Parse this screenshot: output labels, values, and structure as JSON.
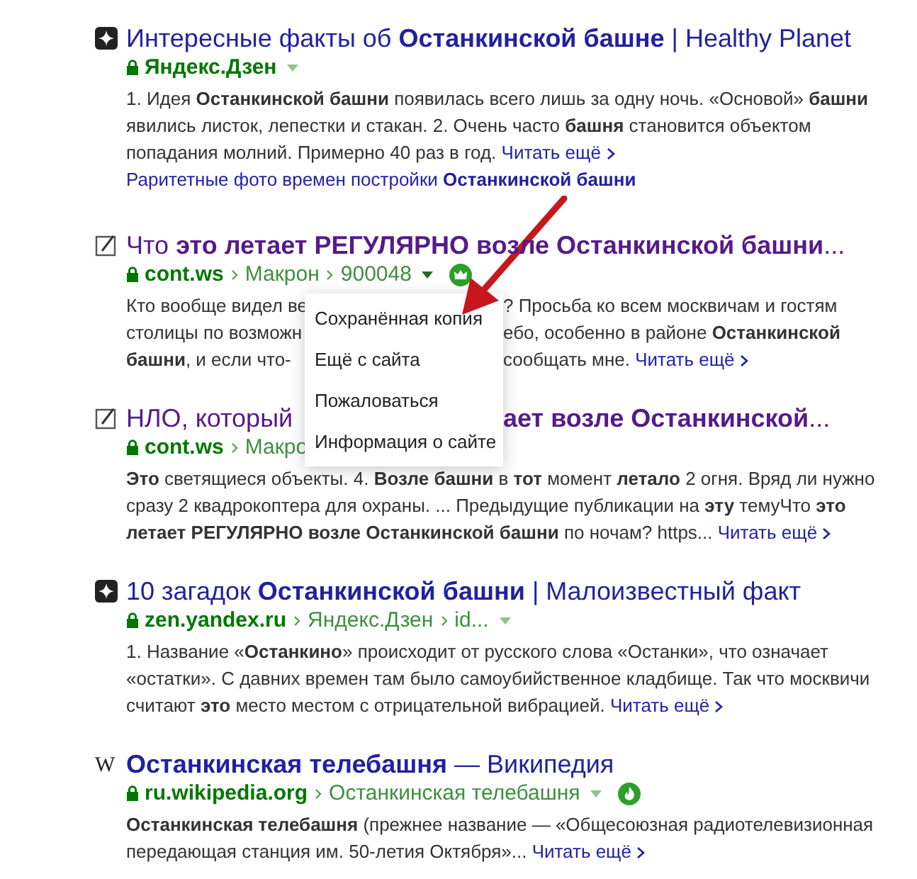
{
  "results": [
    {
      "favicon": {
        "kind": "dzen"
      },
      "visited": false,
      "title_parts": [
        "Интересные факты об **Останкинской башне** | Healthy Planet"
      ],
      "domain": "Яндекс.Дзен",
      "caret": true,
      "snippet": "1. Идея **Останкинской башни** появилась всего лишь за одну ночь. «Основой» **башни** явились листок, лепестки и стакан. 2. Очень часто **башня** становится объектом попадания молний. Примерно 40 раз в год.",
      "read_more": "Читать ещё",
      "sitelink": "Раритетные фото времен постройки **Останкинской башни**"
    },
    {
      "favicon": {
        "kind": "pencil"
      },
      "visited": true,
      "title_parts": [
        "Что **это летает РЕГУЛЯРНО возле Останкинской башни**..."
      ],
      "domain": "cont.ws",
      "breadcrumbs": [
        "Макрон",
        "900048"
      ],
      "caret": true,
      "menu_open": true,
      "badge": {
        "kind": "crown"
      },
      "snippet_lines": [
        {
          "left": "Кто вообще видел ве",
          "right": "? Просьба ко всем москвичам и гостям"
        },
        {
          "left": "столицы по возможн",
          "right": "ебо, особенно в районе **Останкинской**"
        },
        {
          "left": "**башни**, и если что-",
          "right": "сообщать мне."
        }
      ],
      "read_more": "Читать ещё"
    },
    {
      "favicon": {
        "kind": "pencil"
      },
      "visited": true,
      "title_parts": [
        "НЛО, который",
        "**ает возле Останкинской**..."
      ],
      "domain": "cont.ws",
      "breadcrumbs": [
        "Макро"
      ],
      "snippet": "**Это** светящиеся объекты. 4. **Возле башни** в **тот** момент **летало** 2 огня. Вряд ли нужно сразу 2 квадрокоптера для охраны. ... Предыдущие публикации на **эту** темуЧто **это летает РЕГУЛЯРНО возле Останкинской башни** по ночам? https...",
      "read_more": "Читать ещё"
    },
    {
      "favicon": {
        "kind": "dzen"
      },
      "visited": false,
      "title_parts": [
        "10 загадок **Останкинской башни** | Малоизвестный факт"
      ],
      "domain": "zen.yandex.ru",
      "breadcrumbs": [
        "Яндекс.Дзен",
        "id..."
      ],
      "caret": true,
      "snippet": "1. Название «**Останкино**» происходит от русского слова «Останки», что означает «остатки». С давних времен там было самоубийственное кладбище. Так что москвичи считают **это** место местом с отрицательной вибрацией.",
      "read_more": "Читать ещё"
    },
    {
      "favicon": {
        "kind": "letter",
        "letter": "W"
      },
      "visited": false,
      "title_parts": [
        "**Останкинская телебашня** — Википедия"
      ],
      "domain": "ru.wikipedia.org",
      "breadcrumbs": [
        "Останкинская телебашня"
      ],
      "caret": true,
      "badge": {
        "kind": "flame"
      },
      "snippet": "**Останкинская телебашня** (прежнее название — «Общесоюзная радиотелевизионная передающая станция им. 50-летия Октября»...",
      "read_more": "Читать ещё"
    }
  ],
  "context_menu": {
    "items": [
      {
        "label": "Сохранённая копия"
      },
      {
        "label": "Ещё с сайта"
      },
      {
        "label": "Пожаловаться"
      },
      {
        "label": "Информация о сайте"
      }
    ]
  },
  "annotations": [
    {
      "kind": "arrow"
    }
  ]
}
